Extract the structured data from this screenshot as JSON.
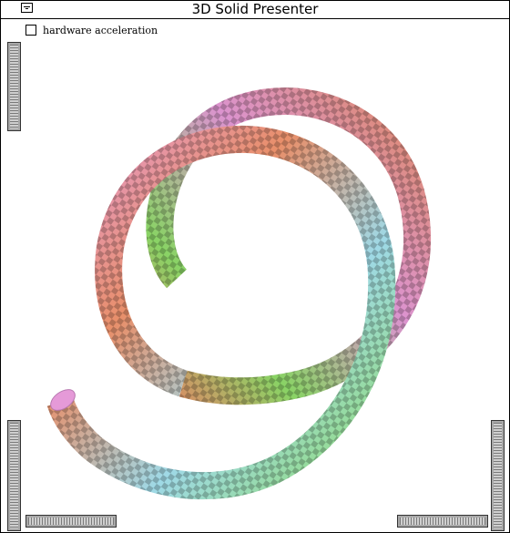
{
  "window": {
    "title": "3D Solid Presenter"
  },
  "controls": {
    "hardware_acceleration": {
      "label": "hardware acceleration",
      "checked": false
    }
  },
  "scene": {
    "object": "helix-tube",
    "texture": "checkerboard",
    "gradient_colors": [
      "#e88f6a",
      "#e59ad8",
      "#9fd9e6",
      "#8fdc6a"
    ]
  }
}
